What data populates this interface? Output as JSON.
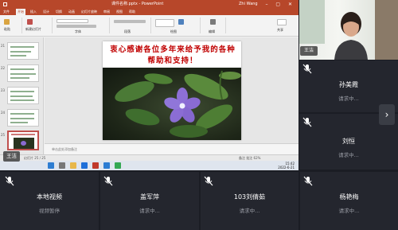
{
  "ppt": {
    "title": "课件名称.pptx - PowerPoint",
    "user": "Zhi Wang",
    "window_controls": "– ▢ ✕",
    "tabs": [
      "文件",
      "开始",
      "插入",
      "设计",
      "切换",
      "动画",
      "幻灯片放映",
      "审阅",
      "视图",
      "帮助"
    ],
    "ribbon_labels": [
      "粘贴",
      "新建幻灯片",
      "字体",
      "段落",
      "绘图",
      "编辑",
      "共享"
    ],
    "slide_numbers": [
      "21",
      "22",
      "23",
      "24",
      "25"
    ],
    "slide_text": "衷心感谢各位多年来给予我的各种帮助和支持！",
    "notes_placeholder": "单击此处添加备注",
    "status_left": "幻灯片 25 / 25",
    "status_right": "备注  批注  62%",
    "clock": "15:42\n2022-6-21"
  },
  "main_speaker": "王洁",
  "camera_speaker": "王洁",
  "participants": [
    {
      "name": "孙美霞",
      "status": "请求中..."
    },
    {
      "name": "刘恒",
      "status": "请求中..."
    },
    {
      "name": "本地视频",
      "status": "视频暂停"
    },
    {
      "name": "盖军萍",
      "status": "请求中..."
    },
    {
      "name": "103刘倩茹",
      "status": "请求中..."
    },
    {
      "name": "杨艳梅",
      "status": "请求中..."
    }
  ],
  "next_page_icon": "chevron-right-icon",
  "colors": {
    "ppt_accent": "#b7472a",
    "slide_text": "#c00000",
    "background": "#1b1d24",
    "tile": "#24262e"
  }
}
